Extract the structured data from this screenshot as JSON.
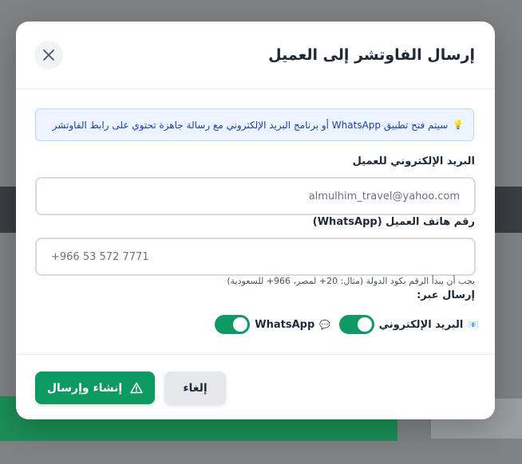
{
  "modal": {
    "title": "إرسال الفاوتشر إلى العميل",
    "info_text": "سيتم فتح تطبيق WhatsApp أو برنامج البريد الإلكتروني مع رسالة جاهزة تحتوي على رابط الفاوتشر",
    "email_label": "البريد الإلكتروني للعميل",
    "email_value": "almulhim_travel@yahoo.com",
    "phone_label": "رقم هاتف العميل (WhatsApp)",
    "phone_value": "+966 53 572 7771",
    "phone_hint": "يجب أن يبدأ الرقم بكود الدولة (مثال: 20+ لمصر، 966+ للسعودية)",
    "send_via_label": "إرسال عبر:",
    "channels": [
      {
        "label": "البريد الإلكتروني",
        "icon": "email-icon",
        "enabled": true
      },
      {
        "label": "WhatsApp",
        "icon": "chat-bubble-icon",
        "enabled": true
      }
    ],
    "primary_button": "إنشاء وإرسال",
    "cancel_button": "إلغاء"
  },
  "colors": {
    "accent_green": "#0c9a62",
    "info_bg": "#ebf4ff",
    "info_text": "#1e40af"
  }
}
